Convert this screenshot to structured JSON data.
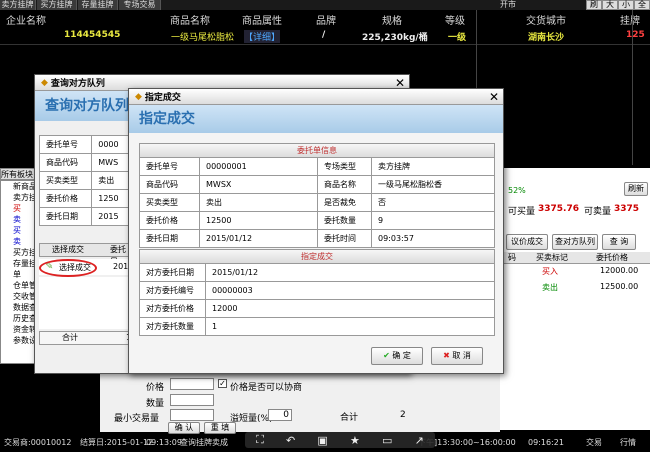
{
  "top_tabs": [
    "卖方挂牌",
    "买方挂牌",
    "存量挂牌",
    "专场交易"
  ],
  "top_right": {
    "label": "开市",
    "buttons": [
      "刷",
      "大",
      "小",
      "全"
    ]
  },
  "market": {
    "headers": [
      "企业名称",
      "商品名称",
      "商品属性",
      "品牌",
      "规格",
      "等级",
      "交货城市",
      "挂牌"
    ],
    "row": {
      "enterprise": "114454545",
      "product": "一级马尾松脂松",
      "attr": "【详细】",
      "brand": "/",
      "spec": "225,230kg/桶",
      "grade": "一级",
      "city": "湖南长沙",
      "listing": "125"
    }
  },
  "left_panel": {
    "title": "所有板块",
    "items": [
      "新商品",
      "卖方挂",
      "买",
      "卖",
      "买",
      "卖",
      "买方挂",
      "存量挂",
      "单",
      "仓单管",
      "交收管",
      "数据查",
      "历史查",
      "资金转",
      "参数设"
    ]
  },
  "right_panel": {
    "percent": "52%",
    "refresh": "刷新",
    "buy_label": "可买量",
    "buy_value": "3375.76",
    "sell_label": "可卖量",
    "sell_value": "3375",
    "btn_match": "议价成交",
    "btn_queue": "查对方队列",
    "btn_query": "查 询",
    "col_headers": [
      "码",
      "买卖标记",
      "委托价格"
    ],
    "rows": [
      {
        "flag": "买入",
        "price": "12000.00"
      },
      {
        "flag": "卖出",
        "price": "12500.00"
      }
    ]
  },
  "back_win": {
    "title": "查询对方队列",
    "heading": "查询对方队列",
    "fields": [
      {
        "label": "委托单号",
        "value": "0000"
      },
      {
        "label": "商品代码",
        "value": "MWS"
      },
      {
        "label": "买卖类型",
        "value": "卖出"
      },
      {
        "label": "委托价格",
        "value": "1250"
      },
      {
        "label": "委托日期",
        "value": "2015"
      }
    ],
    "list_headers": [
      "选择成交",
      "委托日"
    ],
    "list_row": {
      "select": "选择成交",
      "date": "20150"
    },
    "total_label": "合计",
    "total_value": "1"
  },
  "bottom_form": {
    "price_label": "价格",
    "checkbox_label": "价格是否可以协商",
    "qty_label": "数量",
    "min_label": "最小交易量",
    "overflow_label": "溢短量(%)",
    "overflow_value": "0",
    "confirm": "确 认",
    "reset": "重 填",
    "total_label": "合计",
    "total_value": "2"
  },
  "dialog": {
    "title": "指定成交",
    "heading": "指定成交",
    "section1": "委托单信息",
    "info": [
      {
        "l1": "委托单号",
        "v1": "00000001",
        "l2": "专场类型",
        "v2": "卖方挂牌"
      },
      {
        "l1": "商品代码",
        "v1": "MWSX",
        "l2": "商品名称",
        "v2": "一级马尾松脂松香"
      },
      {
        "l1": "买卖类型",
        "v1": "卖出",
        "l2": "是否裁免",
        "v2": "否"
      },
      {
        "l1": "委托价格",
        "v1": "12500",
        "l2": "委托数量",
        "v2": "9"
      },
      {
        "l1": "委托日期",
        "v1": "2015/01/12",
        "l2": "委托时间",
        "v2": "09:03:57"
      }
    ],
    "section2": "指定成交",
    "match": [
      {
        "label": "对方委托日期",
        "value": "2015/01/12"
      },
      {
        "label": "对方委托编号",
        "value": "00000003"
      },
      {
        "label": "对方委托价格",
        "value": "12000"
      },
      {
        "label": "对方委托数量",
        "value": "1"
      }
    ],
    "ok": "确 定",
    "cancel": "取 消"
  },
  "status": {
    "trader": "交易商:00010012",
    "settle": "结算日:2015-01-12",
    "time": "09:13:09",
    "msg": "查询挂牌卖成",
    "session": "下午]13:30:00~16:00:00",
    "clock": "09:16:21",
    "right1": "交易",
    "right2": "行情"
  }
}
